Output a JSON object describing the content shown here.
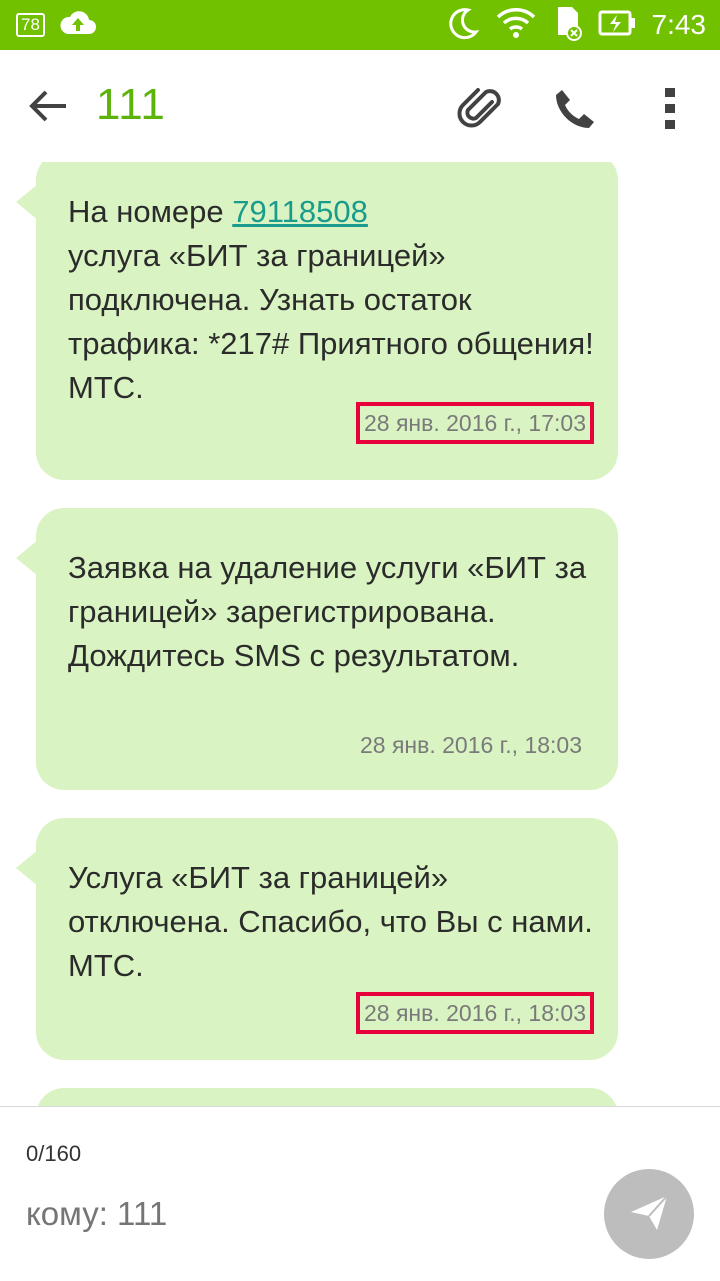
{
  "status_bar": {
    "battery_level": "78",
    "time": "7:43",
    "icons": [
      "battery-level-icon",
      "cloud-upload-icon",
      "moon-icon",
      "wifi-icon",
      "sd-card-icon",
      "battery-charging-icon"
    ],
    "background_color": "#71c100"
  },
  "toolbar": {
    "title": "111",
    "icons": [
      "back-arrow-icon",
      "paperclip-icon",
      "phone-icon",
      "more-vert-icon"
    ],
    "title_color": "#5cb30a"
  },
  "messages": [
    {
      "text_before_link": "На номере ",
      "link": "79118508",
      "text_after_link": "услуга «БИТ за границей» подключена. Узнать остаток трафика: *217# Приятного общения! МТС.",
      "time": "28 янв. 2016 г., 17:03",
      "time_highlighted": true
    },
    {
      "text": "Заявка на удаление  услуги «БИТ за границей» зарегистрирована. Дождитесь SMS с результатом.",
      "time": "28 янв. 2016 г., 18:03",
      "time_highlighted": false
    },
    {
      "text": "Услуга «БИТ за границей» отключена. Спасибо, что Вы с нами. МТС.",
      "time": "28 янв. 2016 г., 18:03",
      "time_highlighted": true
    }
  ],
  "bubble_color": "#d9f4c2",
  "highlight_color": "#e8003a",
  "compose": {
    "char_count": "0/160",
    "recipient_placeholder": "кому: 111",
    "send_icon": "send-icon"
  }
}
